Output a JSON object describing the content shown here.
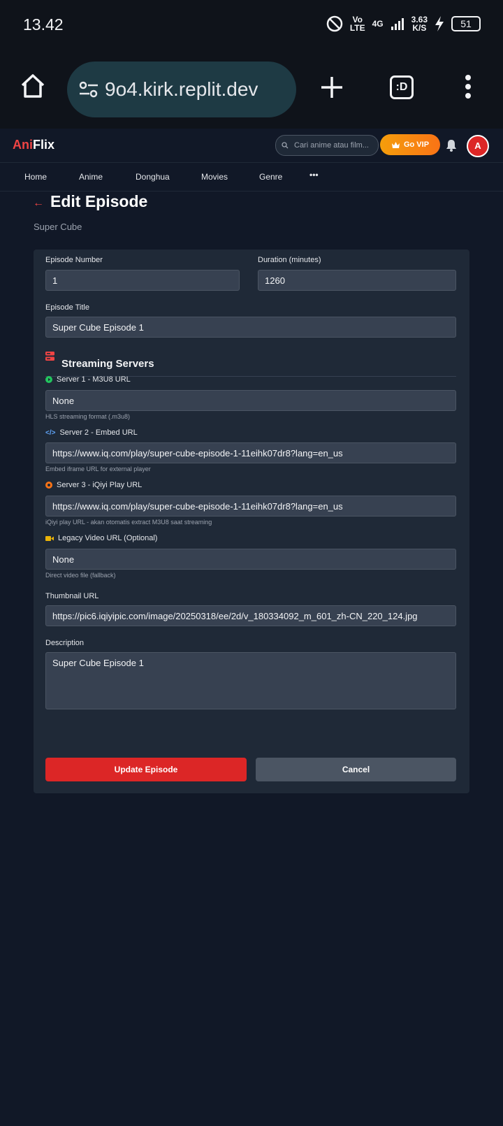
{
  "status_bar": {
    "time": "13.42",
    "volte": "Vo\nLTE",
    "network": "4G",
    "speed_value": "3.63",
    "speed_unit": "K/S",
    "battery": "51"
  },
  "browser": {
    "url": "9o4.kirk.replit.dev",
    "tab_switcher_label": ":D"
  },
  "header": {
    "logo_part1": "Ani",
    "logo_part2": "Flix",
    "search_placeholder": "Cari anime atau film...",
    "vip_label": "Go VIP",
    "avatar_initial": "A"
  },
  "nav": {
    "items": [
      "Home",
      "Anime",
      "Donghua",
      "Movies",
      "Genre"
    ],
    "more": "•••"
  },
  "page": {
    "back_arrow": "←",
    "title": "Edit Episode",
    "subtitle": "Super Cube"
  },
  "form": {
    "episode_number_label": "Episode Number",
    "episode_number_value": "1",
    "duration_label": "Duration (minutes)",
    "duration_value": "1260",
    "episode_title_label": "Episode Title",
    "episode_title_value": "Super Cube Episode 1",
    "streaming_servers_title": "Streaming Servers",
    "server1_label": "Server 1 - M3U8 URL",
    "server1_value": "None",
    "server1_hint": "HLS streaming format (.m3u8)",
    "server2_label": "Server 2 - Embed URL",
    "server2_value": "https://www.iq.com/play/super-cube-episode-1-11eihk07dr8?lang=en_us",
    "server2_hint": "Embed iframe URL for external player",
    "server3_label": "Server 3 - iQiyi Play URL",
    "server3_value": "https://www.iq.com/play/super-cube-episode-1-11eihk07dr8?lang=en_us",
    "server3_hint": "iQiyi play URL - akan otomatis extract M3U8 saat streaming",
    "legacy_label": "Legacy Video URL (Optional)",
    "legacy_value": "None",
    "legacy_hint": "Direct video file (fallback)",
    "thumbnail_label": "Thumbnail URL",
    "thumbnail_value": "https://pic6.iqiyipic.com/image/20250318/ee/2d/v_180334092_m_601_zh-CN_220_124.jpg",
    "description_label": "Description",
    "description_value": "Super Cube Episode 1",
    "update_button": "Update Episode",
    "cancel_button": "Cancel"
  },
  "colors": {
    "accent": "#dc2626",
    "background": "#111827",
    "card": "#1f2937",
    "vip": "#f59e0b"
  }
}
